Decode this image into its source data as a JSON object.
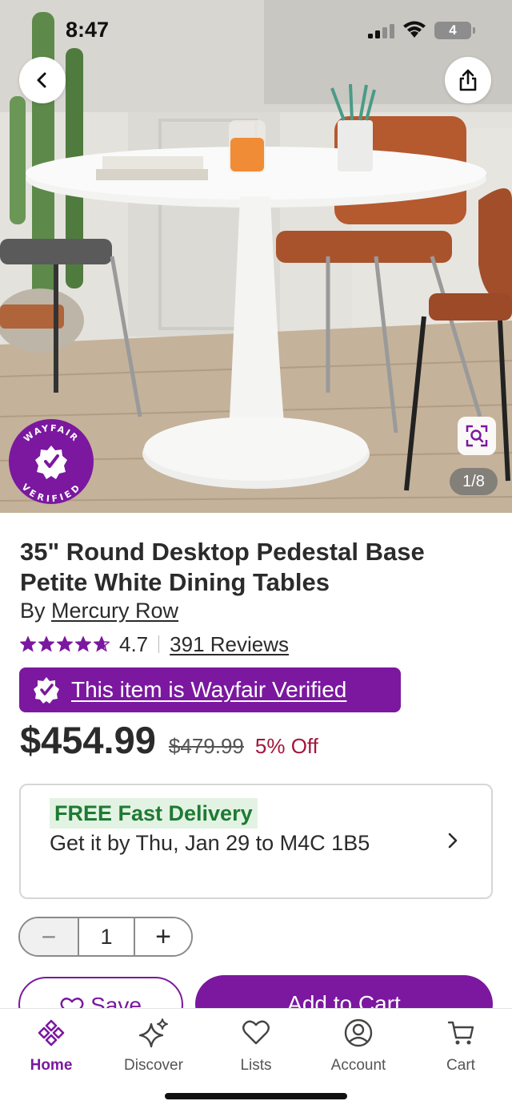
{
  "status_bar": {
    "time": "8:47",
    "battery": "4"
  },
  "gallery": {
    "counter": "1/8",
    "seal_text_top": "WAYFAIR",
    "seal_text_bottom": "VERIFIED"
  },
  "product": {
    "title": "35\" Round Desktop Pedestal Base Petite White Dining Tables",
    "by_prefix": "By",
    "brand": "Mercury Row",
    "rating": "4.7",
    "stars_filled": 4.7,
    "stars_total": 5,
    "reviews": "391 Reviews",
    "verified_text": "This item is Wayfair Verified",
    "price": "$454.99",
    "was_price": "$479.99",
    "discount": "5% Off"
  },
  "delivery": {
    "badge": "FREE Fast Delivery",
    "text": "Get it by Thu, Jan 29 to M4C 1B5"
  },
  "quantity": {
    "minus": "−",
    "value": "1",
    "plus": "+"
  },
  "actions": {
    "save": "Save",
    "add_to_cart": "Add to Cart"
  },
  "nav": {
    "home": "Home",
    "discover": "Discover",
    "lists": "Lists",
    "account": "Account",
    "cart": "Cart"
  },
  "colors": {
    "brand_purple": "#7b189f",
    "discount_red": "#a3163a",
    "delivery_green": "#1e7a34"
  }
}
